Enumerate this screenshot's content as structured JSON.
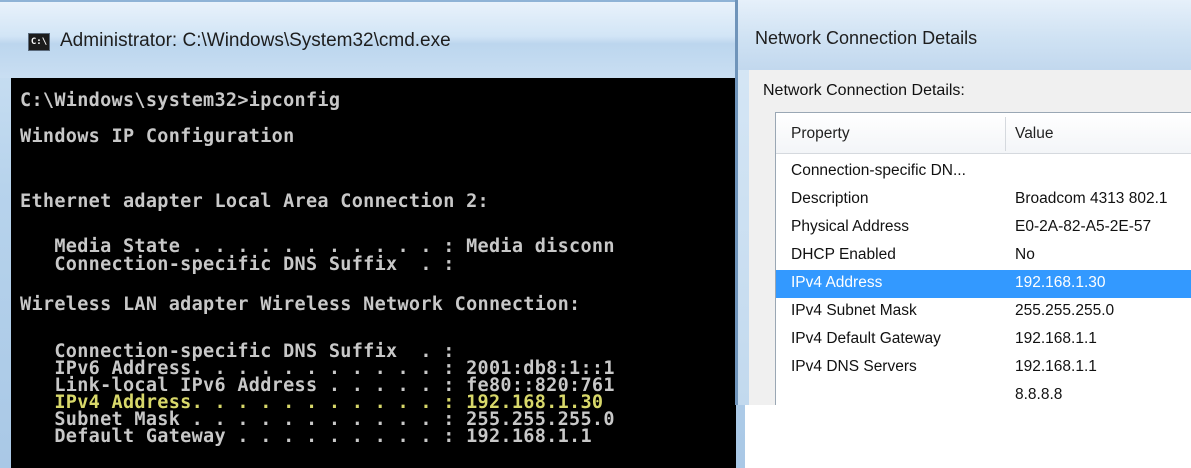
{
  "cmd": {
    "title": "Administrator: C:\\Windows\\System32\\cmd.exe",
    "icon": "cmd-console-icon",
    "icon_glyph": "C:\\",
    "lines": [
      "C:\\Windows\\system32>ipconfig",
      "Windows IP Configuration",
      "Ethernet adapter Local Area Connection 2:",
      "   Media State . . . . . . . . . . . : Media disconn",
      "   Connection-specific DNS Suffix  . :",
      "Wireless LAN adapter Wireless Network Connection:",
      "   Connection-specific DNS Suffix  . :",
      "   IPv6 Address. . . . . . . . . . . : 2001:db8:1::1",
      "   Link-local IPv6 Address . . . . . : fe80::820:761",
      "   IPv4 Address. . . . . . . . . . . : 192.168.1.30",
      "   Subnet Mask . . . . . . . . . . . : 255.255.255.0",
      "   Default Gateway . . . . . . . . . : 192.168.1.1"
    ],
    "highlight_color": "#d8d86a",
    "text_color": "#c8c8c8"
  },
  "dialog": {
    "title": "Network Connection Details",
    "label": "Network Connection Details:",
    "columns": [
      "Property",
      "Value"
    ],
    "rows": [
      {
        "property": "Connection-specific DN...",
        "value": ""
      },
      {
        "property": "Description",
        "value": "Broadcom 4313 802.1"
      },
      {
        "property": "Physical Address",
        "value": "E0-2A-82-A5-2E-57"
      },
      {
        "property": "DHCP Enabled",
        "value": "No"
      },
      {
        "property": "IPv4 Address",
        "value": "192.168.1.30"
      },
      {
        "property": "IPv4 Subnet Mask",
        "value": "255.255.255.0"
      },
      {
        "property": "IPv4 Default Gateway",
        "value": "192.168.1.1"
      },
      {
        "property": "IPv4 DNS Servers",
        "value": "192.168.1.1"
      },
      {
        "property": "",
        "value": "8.8.8.8"
      }
    ],
    "selected_row": "IPv4 Address",
    "selection_color": "#3399ff"
  }
}
